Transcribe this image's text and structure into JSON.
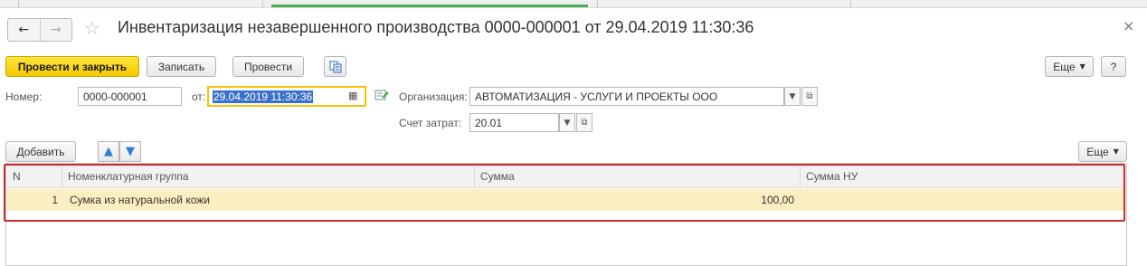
{
  "window": {
    "title": "Инвентаризация незавершенного производства 0000-000001 от 29.04.2019 11:30:36"
  },
  "nav": {
    "back": "←",
    "forward": "→",
    "star": "☆",
    "close": "×"
  },
  "toolbar": {
    "post_and_close": "Провести и закрыть",
    "save": "Записать",
    "post": "Провести",
    "more": "Еще",
    "help": "?"
  },
  "header": {
    "number_label": "Номер:",
    "number_value": "0000-000001",
    "date_label": "от:",
    "date_value": "29.04.2019 11:30:36",
    "org_label": "Организация:",
    "org_value": "АВТОМАТИЗАЦИЯ - УСЛУГИ И ПРОЕКТЫ ООО",
    "account_label": "Счет затрат:",
    "account_value": "20.01"
  },
  "table_toolbar": {
    "add": "Добавить",
    "more": "Еще"
  },
  "table": {
    "columns": [
      "N",
      "Номенклатурная группа",
      "Сумма",
      "Сумма НУ"
    ],
    "rows": [
      {
        "n": "1",
        "group": "Сумка из натуральной кожи",
        "sum": "100,00",
        "sum_nu": ""
      }
    ]
  }
}
